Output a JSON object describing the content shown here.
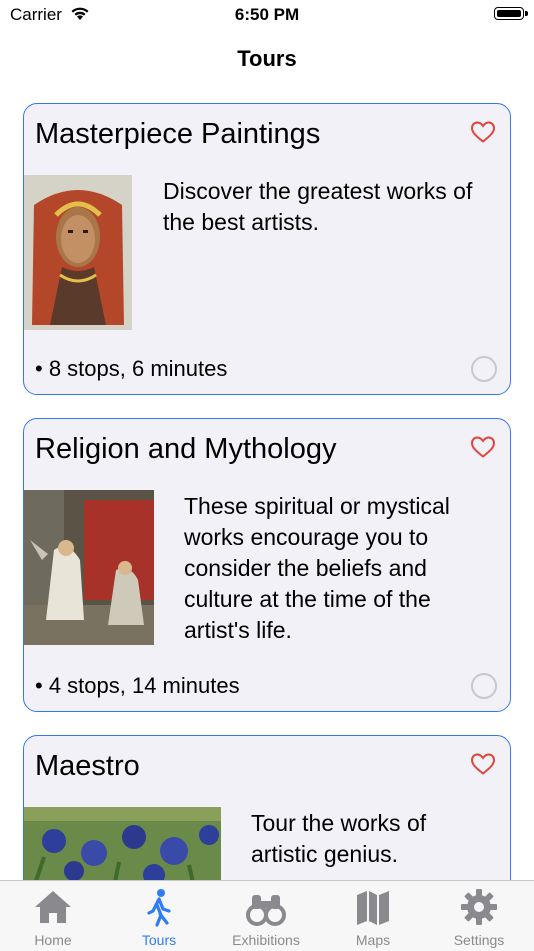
{
  "status_bar": {
    "carrier": "Carrier",
    "time": "6:50 PM"
  },
  "nav": {
    "title": "Tours"
  },
  "tours": [
    {
      "title": "Masterpiece Paintings",
      "description": "Discover the greatest works of the best artists.",
      "meta": "• 8 stops, 6 minutes",
      "favorite_icon": "heart-outline-icon"
    },
    {
      "title": "Religion and Mythology",
      "description": "These spiritual or mystical works encourage you to consider the beliefs and culture at the time of the artist's life.",
      "meta": "• 4 stops, 14 minutes",
      "favorite_icon": "heart-outline-icon"
    },
    {
      "title": "Maestro",
      "description": "Tour the works of artistic genius.",
      "favorite_icon": "heart-outline-icon"
    }
  ],
  "tabs": [
    {
      "label": "Home",
      "icon": "house-icon",
      "active": false
    },
    {
      "label": "Tours",
      "icon": "walking-person-icon",
      "active": true
    },
    {
      "label": "Exhibitions",
      "icon": "binoculars-icon",
      "active": false
    },
    {
      "label": "Maps",
      "icon": "map-icon",
      "active": false
    },
    {
      "label": "Settings",
      "icon": "gear-icon",
      "active": false
    }
  ],
  "colors": {
    "accent": "#3478f6",
    "heart": "#e0453a",
    "card_bg": "#f2f1f7",
    "tab_inactive": "#8a8a8e"
  }
}
